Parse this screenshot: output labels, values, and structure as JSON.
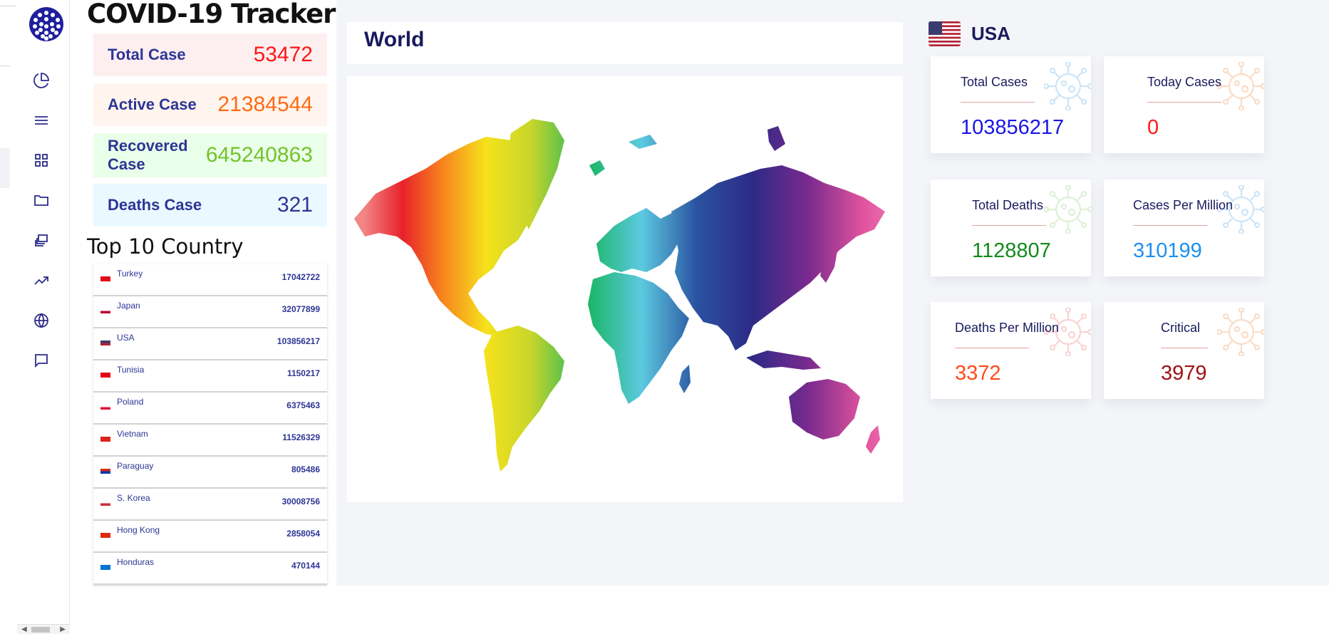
{
  "app": {
    "title": "COVID-19 Tracker"
  },
  "sidebar": {
    "icons": [
      "pie-chart-icon",
      "menu-icon",
      "grid-icon",
      "folder-icon",
      "layers-icon",
      "trending-up-icon",
      "globe-icon",
      "message-icon"
    ]
  },
  "summary": {
    "total": {
      "label": "Total Case",
      "value": "53472"
    },
    "active": {
      "label": "Active Case",
      "value": "21384544"
    },
    "recovered": {
      "label": "Recovered Case",
      "value": "645240863"
    },
    "deaths": {
      "label": "Deaths Case",
      "value": "321"
    }
  },
  "top_countries": {
    "title": "Top 10 Country",
    "rows": [
      {
        "name": "Turkey",
        "count": "17042722",
        "flag": [
          "#e30a17",
          "#e30a17"
        ]
      },
      {
        "name": "Japan",
        "count": "32077899",
        "flag": [
          "#ffffff",
          "#bc002d"
        ]
      },
      {
        "name": "USA",
        "count": "103856217",
        "flag": [
          "#3c3b6e",
          "#b22234"
        ]
      },
      {
        "name": "Tunisia",
        "count": "1150217",
        "flag": [
          "#e70013",
          "#e70013"
        ]
      },
      {
        "name": "Poland",
        "count": "6375463",
        "flag": [
          "#ffffff",
          "#dc143c"
        ]
      },
      {
        "name": "Vietnam",
        "count": "11526329",
        "flag": [
          "#da251d",
          "#da251d"
        ]
      },
      {
        "name": "Paraguay",
        "count": "805486",
        "flag": [
          "#d52b1e",
          "#0038a8"
        ]
      },
      {
        "name": "S. Korea",
        "count": "30008756",
        "flag": [
          "#ffffff",
          "#cd2e3a"
        ]
      },
      {
        "name": "Hong Kong",
        "count": "2858054",
        "flag": [
          "#de2910",
          "#de2910"
        ]
      },
      {
        "name": "Honduras",
        "count": "470144",
        "flag": [
          "#0073cf",
          "#0073cf"
        ]
      }
    ]
  },
  "world": {
    "title": "World"
  },
  "country": {
    "name": "USA",
    "cards": [
      {
        "title": "Total Cases",
        "value": "103856217",
        "color": "#1a16e6"
      },
      {
        "title": "Today Cases",
        "value": "0",
        "color": "#ff1616"
      },
      {
        "title": "Total Deaths",
        "value": "1128807",
        "color": "#138a1b"
      },
      {
        "title": "Cases Per Million",
        "value": "310199",
        "color": "#1e90f0"
      },
      {
        "title": "Deaths Per Million",
        "value": "3372",
        "color": "#ff4b1a"
      },
      {
        "title": "Critical",
        "value": "3979",
        "color": "#a01212"
      }
    ]
  },
  "colors": {
    "accent": "#2d3594",
    "background": "#f4f5f9"
  }
}
